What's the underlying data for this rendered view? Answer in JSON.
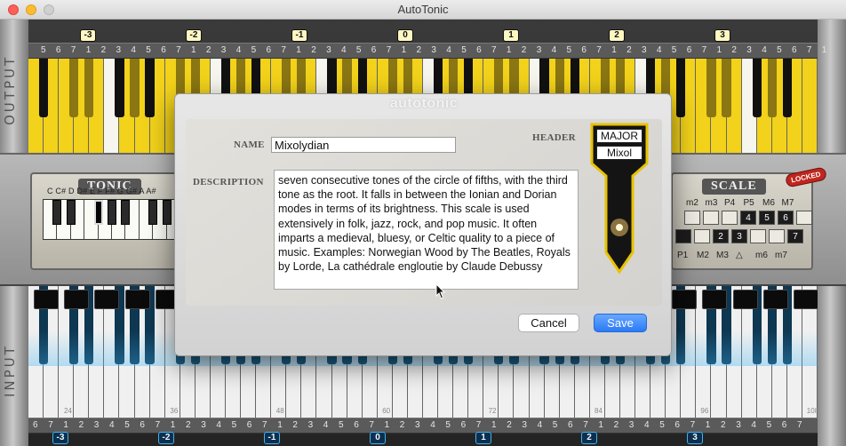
{
  "window": {
    "title": "AutoTonic"
  },
  "output": {
    "rail_label": "OUTPUT",
    "octave_badges": [
      "-3",
      "-2",
      "-1",
      "0",
      "1",
      "2",
      "3"
    ],
    "degree_numbers": [
      "5",
      "6",
      "7",
      "1",
      "2",
      "3",
      "4",
      "5",
      "6",
      "7",
      "1",
      "2",
      "3",
      "4",
      "5",
      "6",
      "7",
      "1",
      "2",
      "3",
      "4",
      "5",
      "6",
      "7",
      "1",
      "2",
      "3",
      "4",
      "5",
      "6",
      "7",
      "1",
      "2",
      "3",
      "4",
      "5",
      "6",
      "7",
      "1",
      "2",
      "3",
      "4",
      "5",
      "6",
      "7",
      "1",
      "2",
      "3",
      "4",
      "5",
      "6",
      "7",
      "1"
    ],
    "accent_color": "#f2d21a"
  },
  "input": {
    "rail_label": "INPUT",
    "octave_badges": [
      "-3",
      "-2",
      "-1",
      "0",
      "1",
      "2",
      "3"
    ],
    "note_numbers": [
      "24",
      "36",
      "48",
      "60",
      "72",
      "84",
      "96",
      "108"
    ],
    "degree_numbers": [
      "6",
      "7",
      "1",
      "2",
      "3",
      "4",
      "5",
      "6",
      "7",
      "1",
      "2",
      "3",
      "4",
      "5",
      "6",
      "7",
      "1",
      "2",
      "3",
      "4",
      "5",
      "6",
      "7",
      "1",
      "2",
      "3",
      "4",
      "5",
      "6",
      "7",
      "1",
      "2",
      "3",
      "4",
      "5",
      "6",
      "7",
      "1",
      "2",
      "3",
      "4",
      "5",
      "6",
      "7",
      "1",
      "2",
      "3",
      "4",
      "5",
      "6",
      "7"
    ],
    "accent_color": "#3fb3f0"
  },
  "tonic": {
    "title": "TONIC",
    "notes_label": "C C# D D# E F F# G G# A A#"
  },
  "scale": {
    "title": "SCALE",
    "locked_label": "LOCKED",
    "top_intervals": [
      "m2",
      "m3",
      "P4",
      "P5",
      "M6",
      "M7"
    ],
    "upper_boxes": [
      "4",
      "5",
      "6"
    ],
    "lower_boxes": [
      "2",
      "3",
      "7"
    ],
    "bottom_intervals": [
      "P1",
      "M2",
      "M3",
      "△",
      "m6",
      "m7"
    ]
  },
  "dialog": {
    "watermark": "autotonic",
    "name_label": "NAME",
    "name_value": "Mixolydian",
    "header_label": "HEADER",
    "description_label": "DESCRIPTION",
    "description_value": "seven consecutive tones of the circle of fifths, with the third tone as the root. It falls in between the Ionian and Dorian modes in terms of its brightness. This scale is used extensively in folk, jazz, rock, and pop music. It often imparts a medieval, bluesy, or Celtic quality to a piece of music. Examples: Norwegian Wood by The Beatles, Royals by Lorde, La cathédrale engloutie by Claude Debussy",
    "header_tag_top": "MAJOR",
    "header_tag_bottom": "Mixol",
    "cancel_label": "Cancel",
    "save_label": "Save",
    "save_color": "#2b7af4"
  }
}
